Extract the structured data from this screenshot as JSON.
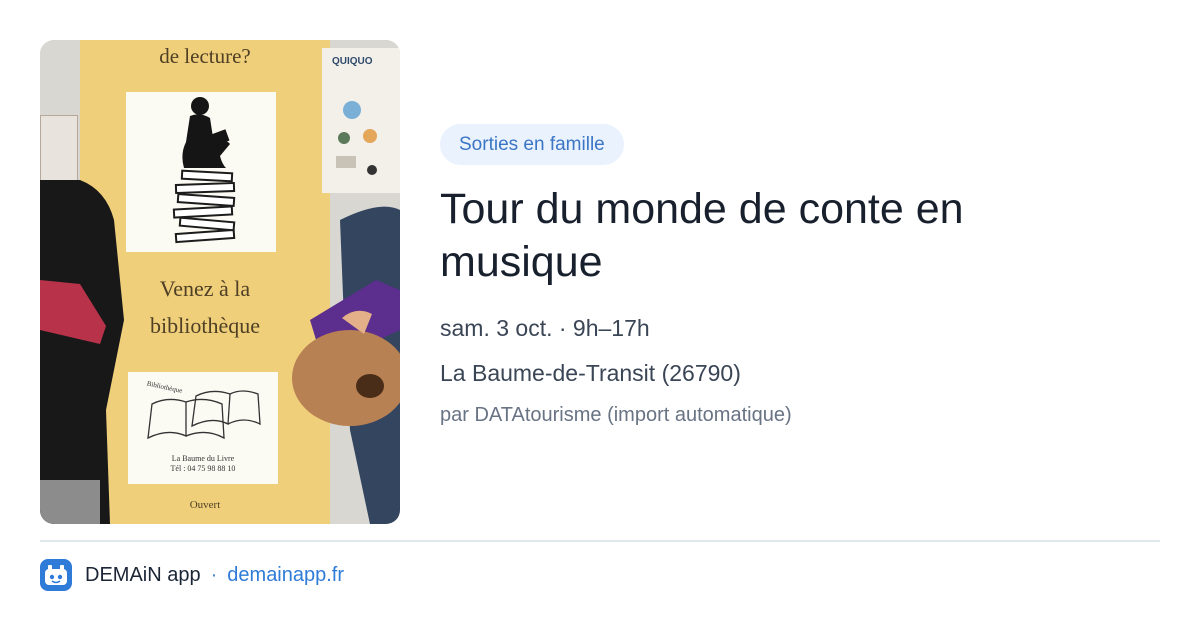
{
  "photo": {
    "alt_scene": "library poster",
    "banner_top": "de lecture?",
    "banner_mid_line1": "Venez à la",
    "banner_mid_line2": "bibliothèque",
    "logo_line1": "La Baume du Livre",
    "logo_line2": "Tél : 04 75 98 88 10",
    "logo_arc": "Bibliothèque",
    "banner_bottom": "Ouvert",
    "poster_right_text": "QUIQUO"
  },
  "tag": {
    "label": "Sorties en famille"
  },
  "event": {
    "title": "Tour du monde de conte en musique",
    "datetime": "sam. 3 oct. · 9h–17h",
    "location": "La Baume-de-Transit (26790)",
    "source": "par DATAtourisme (import automatique)"
  },
  "footer": {
    "app_name": "DEMAiN app",
    "separator": "·",
    "link": "demainapp.fr"
  },
  "colors": {
    "accent": "#2f7bd8",
    "tag_bg": "#eaf2fd",
    "tag_text": "#3b76c5"
  },
  "icons": {
    "app_icon": "demain-app-icon"
  }
}
